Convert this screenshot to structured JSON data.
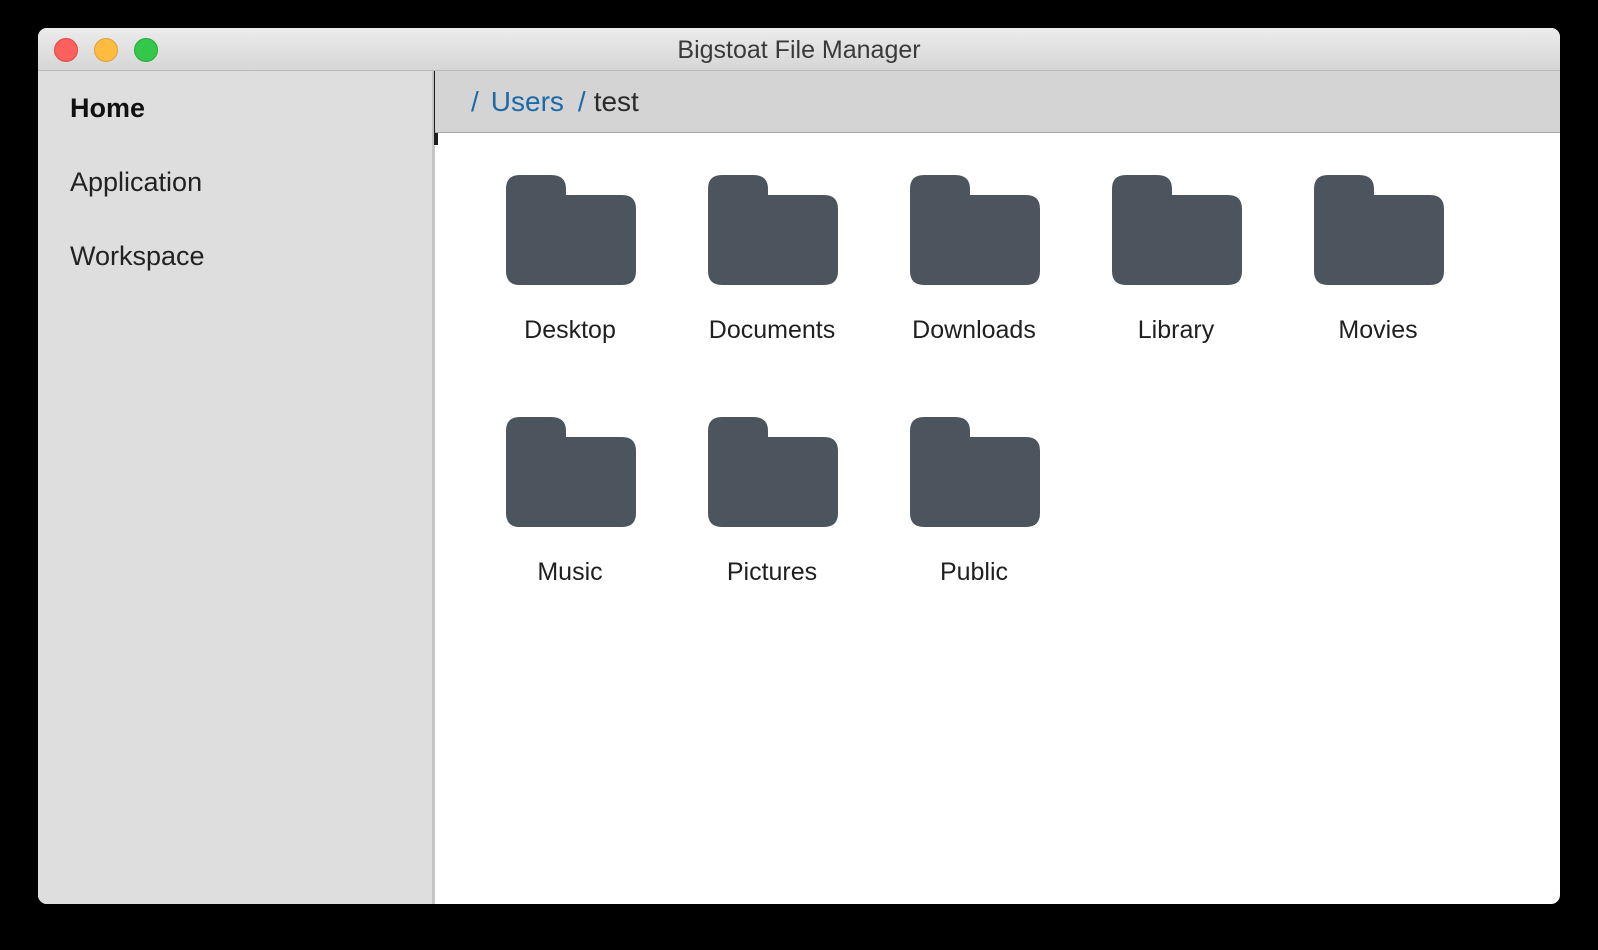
{
  "window": {
    "title": "Bigstoat File Manager"
  },
  "colors": {
    "folder": "#4c545e",
    "link": "#1c6aa8",
    "sidebar_bg": "#dedede",
    "breadcrumb_bg": "#d4d4d4"
  },
  "sidebar": {
    "items": [
      {
        "label": "Home",
        "active": true
      },
      {
        "label": "Application",
        "active": false
      },
      {
        "label": "Workspace",
        "active": false
      }
    ]
  },
  "breadcrumb": {
    "separator": "/",
    "segments": [
      {
        "label": "Users",
        "link": true
      },
      {
        "label": "test",
        "link": false
      }
    ]
  },
  "folders": [
    {
      "name": "Desktop",
      "icon": "folder-icon"
    },
    {
      "name": "Documents",
      "icon": "folder-icon"
    },
    {
      "name": "Downloads",
      "icon": "folder-icon"
    },
    {
      "name": "Library",
      "icon": "folder-icon"
    },
    {
      "name": "Movies",
      "icon": "folder-icon"
    },
    {
      "name": "Music",
      "icon": "folder-icon"
    },
    {
      "name": "Pictures",
      "icon": "folder-icon"
    },
    {
      "name": "Public",
      "icon": "folder-icon"
    }
  ]
}
